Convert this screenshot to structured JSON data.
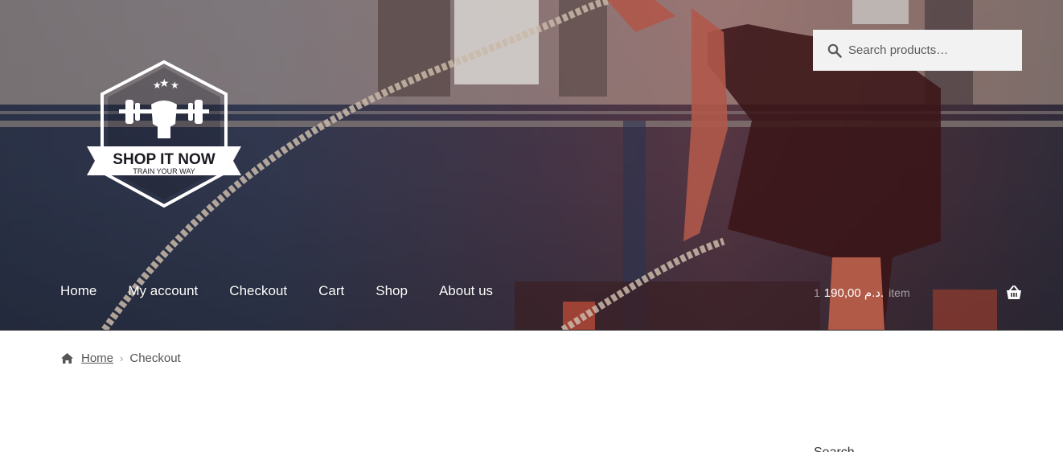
{
  "header": {
    "search": {
      "placeholder": "Search products…"
    },
    "logo": {
      "title": "SHOP IT NOW",
      "tagline": "TRAIN YOUR WAY"
    },
    "nav": [
      {
        "label": "Home"
      },
      {
        "label": "My account"
      },
      {
        "label": "Checkout"
      },
      {
        "label": "Cart"
      },
      {
        "label": "Shop"
      },
      {
        "label": "About us"
      }
    ],
    "cart": {
      "amount": "190,00 د.م.",
      "count_prefix": "1",
      "count": "item"
    }
  },
  "breadcrumb": {
    "home": "Home",
    "separator": "›",
    "current": "Checkout"
  },
  "sidebar": {
    "peek_text": "Search"
  },
  "colors": {
    "nav_text": "#ffffff",
    "search_bg": "#f2f2f2",
    "breadcrumb_text": "#555555"
  }
}
